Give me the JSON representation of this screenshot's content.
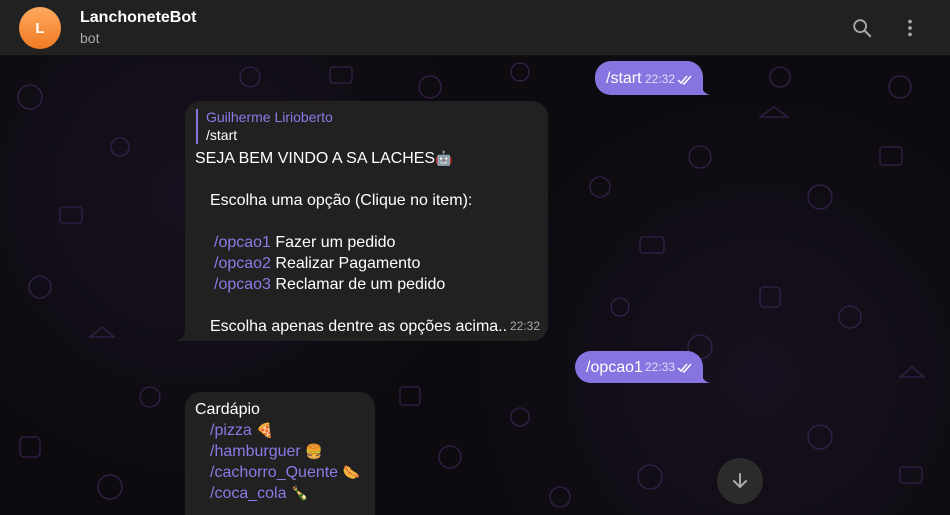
{
  "header": {
    "avatar_letter": "L",
    "title": "LanchoneteBot",
    "status": "bot",
    "search_icon": "search-icon",
    "menu_icon": "more-vertical-icon"
  },
  "colors": {
    "outgoing_bubble": "#8774e1",
    "incoming_bubble": "#212121",
    "link": "#8c7ae6",
    "avatar": "#f79b48"
  },
  "messages": {
    "m1": {
      "text": "/start",
      "time": "22:32"
    },
    "m2": {
      "reply_name": "Guilherme Lirioberto",
      "reply_text": "/start",
      "line1": "SEJA BEM VINDO A SA LACHES",
      "line1_emoji": "🤖",
      "line2": "Escolha uma opção (Clique no item):",
      "options": [
        {
          "cmd": "/opcao1",
          "label": " Fazer um pedido"
        },
        {
          "cmd": "/opcao2",
          "label": " Realizar Pagamento"
        },
        {
          "cmd": "/opcao3",
          "label": " Reclamar de um pedido"
        }
      ],
      "footer": "Escolha apenas dentre as opções acima..",
      "time": "22:32"
    },
    "m3": {
      "text": "/opcao1",
      "time": "22:33"
    },
    "m4": {
      "title": "Cardápio",
      "items": [
        {
          "cmd": "/pizza",
          "emoji": "🍕"
        },
        {
          "cmd": "/hamburguer",
          "emoji": "🍔"
        },
        {
          "cmd": "/cachorro_Quente",
          "emoji": "🌭"
        },
        {
          "cmd": "/coca_cola",
          "emoji": "🍾"
        }
      ]
    }
  },
  "scroll_down_icon": "arrow-down-icon"
}
